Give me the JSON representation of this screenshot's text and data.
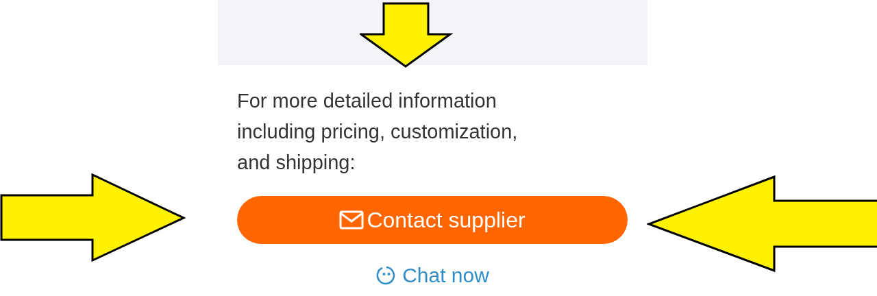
{
  "info_text": "For more detailed information\nincluding pricing, customization,\nand shipping:",
  "contact_button": {
    "label": "Contact supplier"
  },
  "chat_link": {
    "label": "Chat now"
  },
  "annotations": [
    {
      "kind": "down"
    },
    {
      "kind": "right"
    },
    {
      "kind": "left"
    }
  ]
}
